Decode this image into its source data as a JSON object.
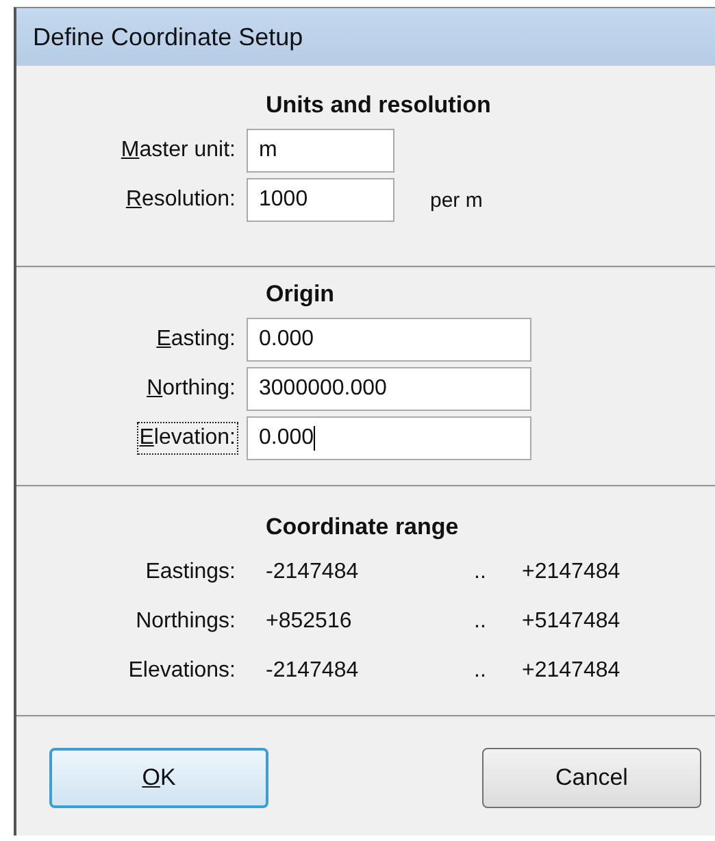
{
  "window": {
    "title": "Define Coordinate Setup"
  },
  "units": {
    "heading": "Units and resolution",
    "fields": [
      {
        "key": "M",
        "rest": "aster unit:",
        "value": "m",
        "focused": false
      },
      {
        "key": "R",
        "rest": "esolution:",
        "value": "1000",
        "focused": false,
        "suffix": "per m"
      }
    ]
  },
  "origin": {
    "heading": "Origin",
    "fields": [
      {
        "key": "E",
        "rest": "asting:",
        "value": "0.000",
        "focused": false
      },
      {
        "key": "N",
        "rest": "orthing:",
        "value": "3000000.000",
        "focused": false
      },
      {
        "key": "E",
        "rest": "levation:",
        "value": "0.000",
        "focused": true
      }
    ]
  },
  "range": {
    "heading": "Coordinate range",
    "rows": [
      {
        "label": "Eastings:",
        "min": "-2147484",
        "sep": "..",
        "max": "+2147484"
      },
      {
        "label": "Northings:",
        "min": "+852516",
        "sep": "..",
        "max": "+5147484"
      },
      {
        "label": "Elevations:",
        "min": "-2147484",
        "sep": "..",
        "max": "+2147484"
      }
    ]
  },
  "buttons": [
    {
      "key": "O",
      "rest": "K",
      "default": true
    },
    {
      "rest": "Cancel",
      "default": false
    }
  ]
}
